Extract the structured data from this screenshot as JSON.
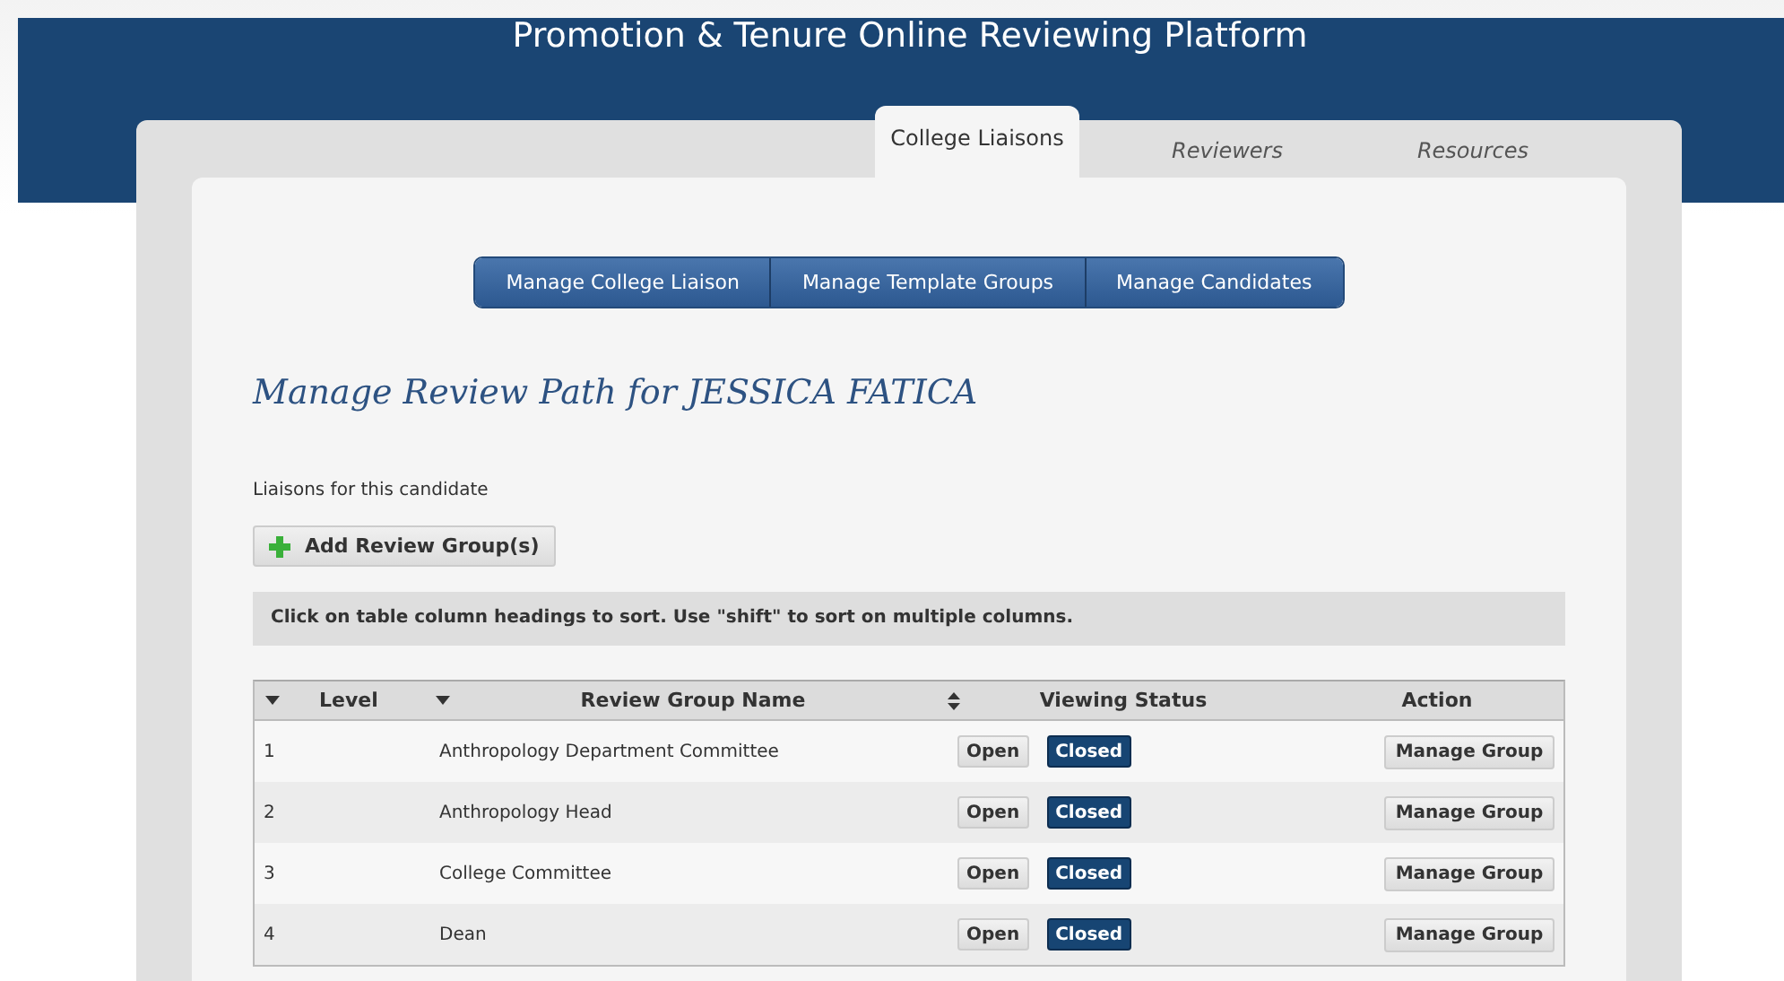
{
  "header": {
    "title": "Promotion & Tenure Online Reviewing Platform"
  },
  "tabs": [
    {
      "label": "College Liaisons",
      "selected": true
    },
    {
      "label": "Reviewers",
      "selected": false
    },
    {
      "label": "Resources",
      "selected": false
    }
  ],
  "nav_buttons": [
    "Manage College Liaison",
    "Manage Template Groups",
    "Manage Candidates"
  ],
  "heading": "Manage Review Path for JESSICA FATICA",
  "liaisons_label": "Liaisons for this candidate",
  "add_button": "Add Review Group(s)",
  "hint": "Click on table column headings to sort. Use \"shift\" to sort on multiple columns.",
  "table": {
    "columns": [
      {
        "label": "Level",
        "kind": "descending"
      },
      {
        "label": "Review Group Name",
        "kind": "descending"
      },
      {
        "label": "Viewing Status",
        "kind": "sortable"
      },
      {
        "label": "Action",
        "kind": "plain"
      }
    ],
    "rows": [
      {
        "level": "1",
        "name": "Anthropology Department Committee",
        "status": [
          {
            "label": "Open",
            "selected": false
          },
          {
            "label": "Closed",
            "selected": true
          }
        ],
        "action": "Manage Group"
      },
      {
        "level": "2",
        "name": "Anthropology Head",
        "status": [
          {
            "label": "Open",
            "selected": false
          },
          {
            "label": "Closed",
            "selected": true
          }
        ],
        "action": "Manage Group"
      },
      {
        "level": "3",
        "name": "College Committee",
        "status": [
          {
            "label": "Open",
            "selected": false
          },
          {
            "label": "Closed",
            "selected": true
          }
        ],
        "action": "Manage Group"
      },
      {
        "level": "4",
        "name": "Dean",
        "status": [
          {
            "label": "Open",
            "selected": false
          },
          {
            "label": "Closed",
            "selected": true
          }
        ],
        "action": "Manage Group"
      }
    ]
  }
}
